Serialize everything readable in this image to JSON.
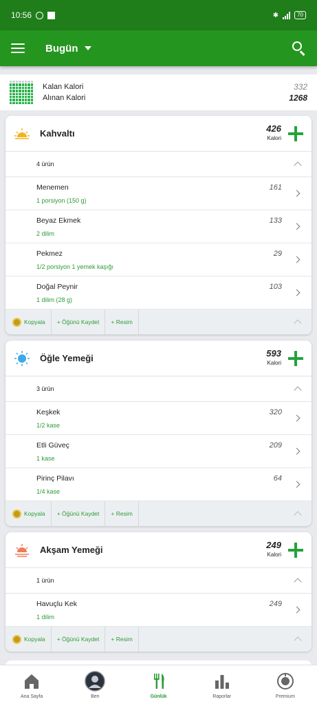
{
  "status": {
    "time": "10:56",
    "battery": "70"
  },
  "header": {
    "title": "Bugün"
  },
  "summary": {
    "remaining_label": "Kalan Kalori",
    "eaten_label": "Alınan Kalori",
    "remaining_value": "332",
    "eaten_value": "1268"
  },
  "meals": [
    {
      "name": "Kahvaltı",
      "kcal": "426",
      "kcal_unit": "Kalori",
      "count": "4 ürün",
      "items": [
        {
          "name": "Menemen",
          "serving": "1 porsiyon (150 g)",
          "kcal": "161"
        },
        {
          "name": "Beyaz Ekmek",
          "serving": "2 dilim",
          "kcal": "133"
        },
        {
          "name": "Pekmez",
          "serving": "1/2 porsiyon 1 yemek kaşığı",
          "kcal": "29"
        },
        {
          "name": "Doğal Peynir",
          "serving": "1 dilim (28 g)",
          "kcal": "103"
        }
      ]
    },
    {
      "name": "Öğle Yemeği",
      "kcal": "593",
      "kcal_unit": "Kalori",
      "count": "3 ürün",
      "items": [
        {
          "name": "Keşkek",
          "serving": "1/2 kase",
          "kcal": "320"
        },
        {
          "name": "Etli Güveç",
          "serving": "1 kase",
          "kcal": "209"
        },
        {
          "name": "Pirinç Pilavı",
          "serving": "1/4 kase",
          "kcal": "64"
        }
      ]
    },
    {
      "name": "Akşam Yemeği",
      "kcal": "249",
      "kcal_unit": "Kalori",
      "count": "1 ürün",
      "items": [
        {
          "name": "Havuçlu Kek",
          "serving": "1 dilim",
          "kcal": "249"
        }
      ]
    }
  ],
  "actions": {
    "copy": "Kopyala",
    "save_meal": "+ Öğünü Kaydet",
    "photo": "+ Resim"
  },
  "nav": [
    {
      "label": "Ana Sayfa",
      "icon": "home-icon"
    },
    {
      "label": "Ben",
      "icon": "avatar"
    },
    {
      "label": "Günlük",
      "icon": "fork-knife-icon"
    },
    {
      "label": "Raporlar",
      "icon": "bar-chart-icon"
    },
    {
      "label": "Premium",
      "icon": "premium-icon"
    }
  ],
  "colors": {
    "statusbar": "#1f7d1a",
    "appbar": "#24951f",
    "accent": "#2e9b38"
  }
}
